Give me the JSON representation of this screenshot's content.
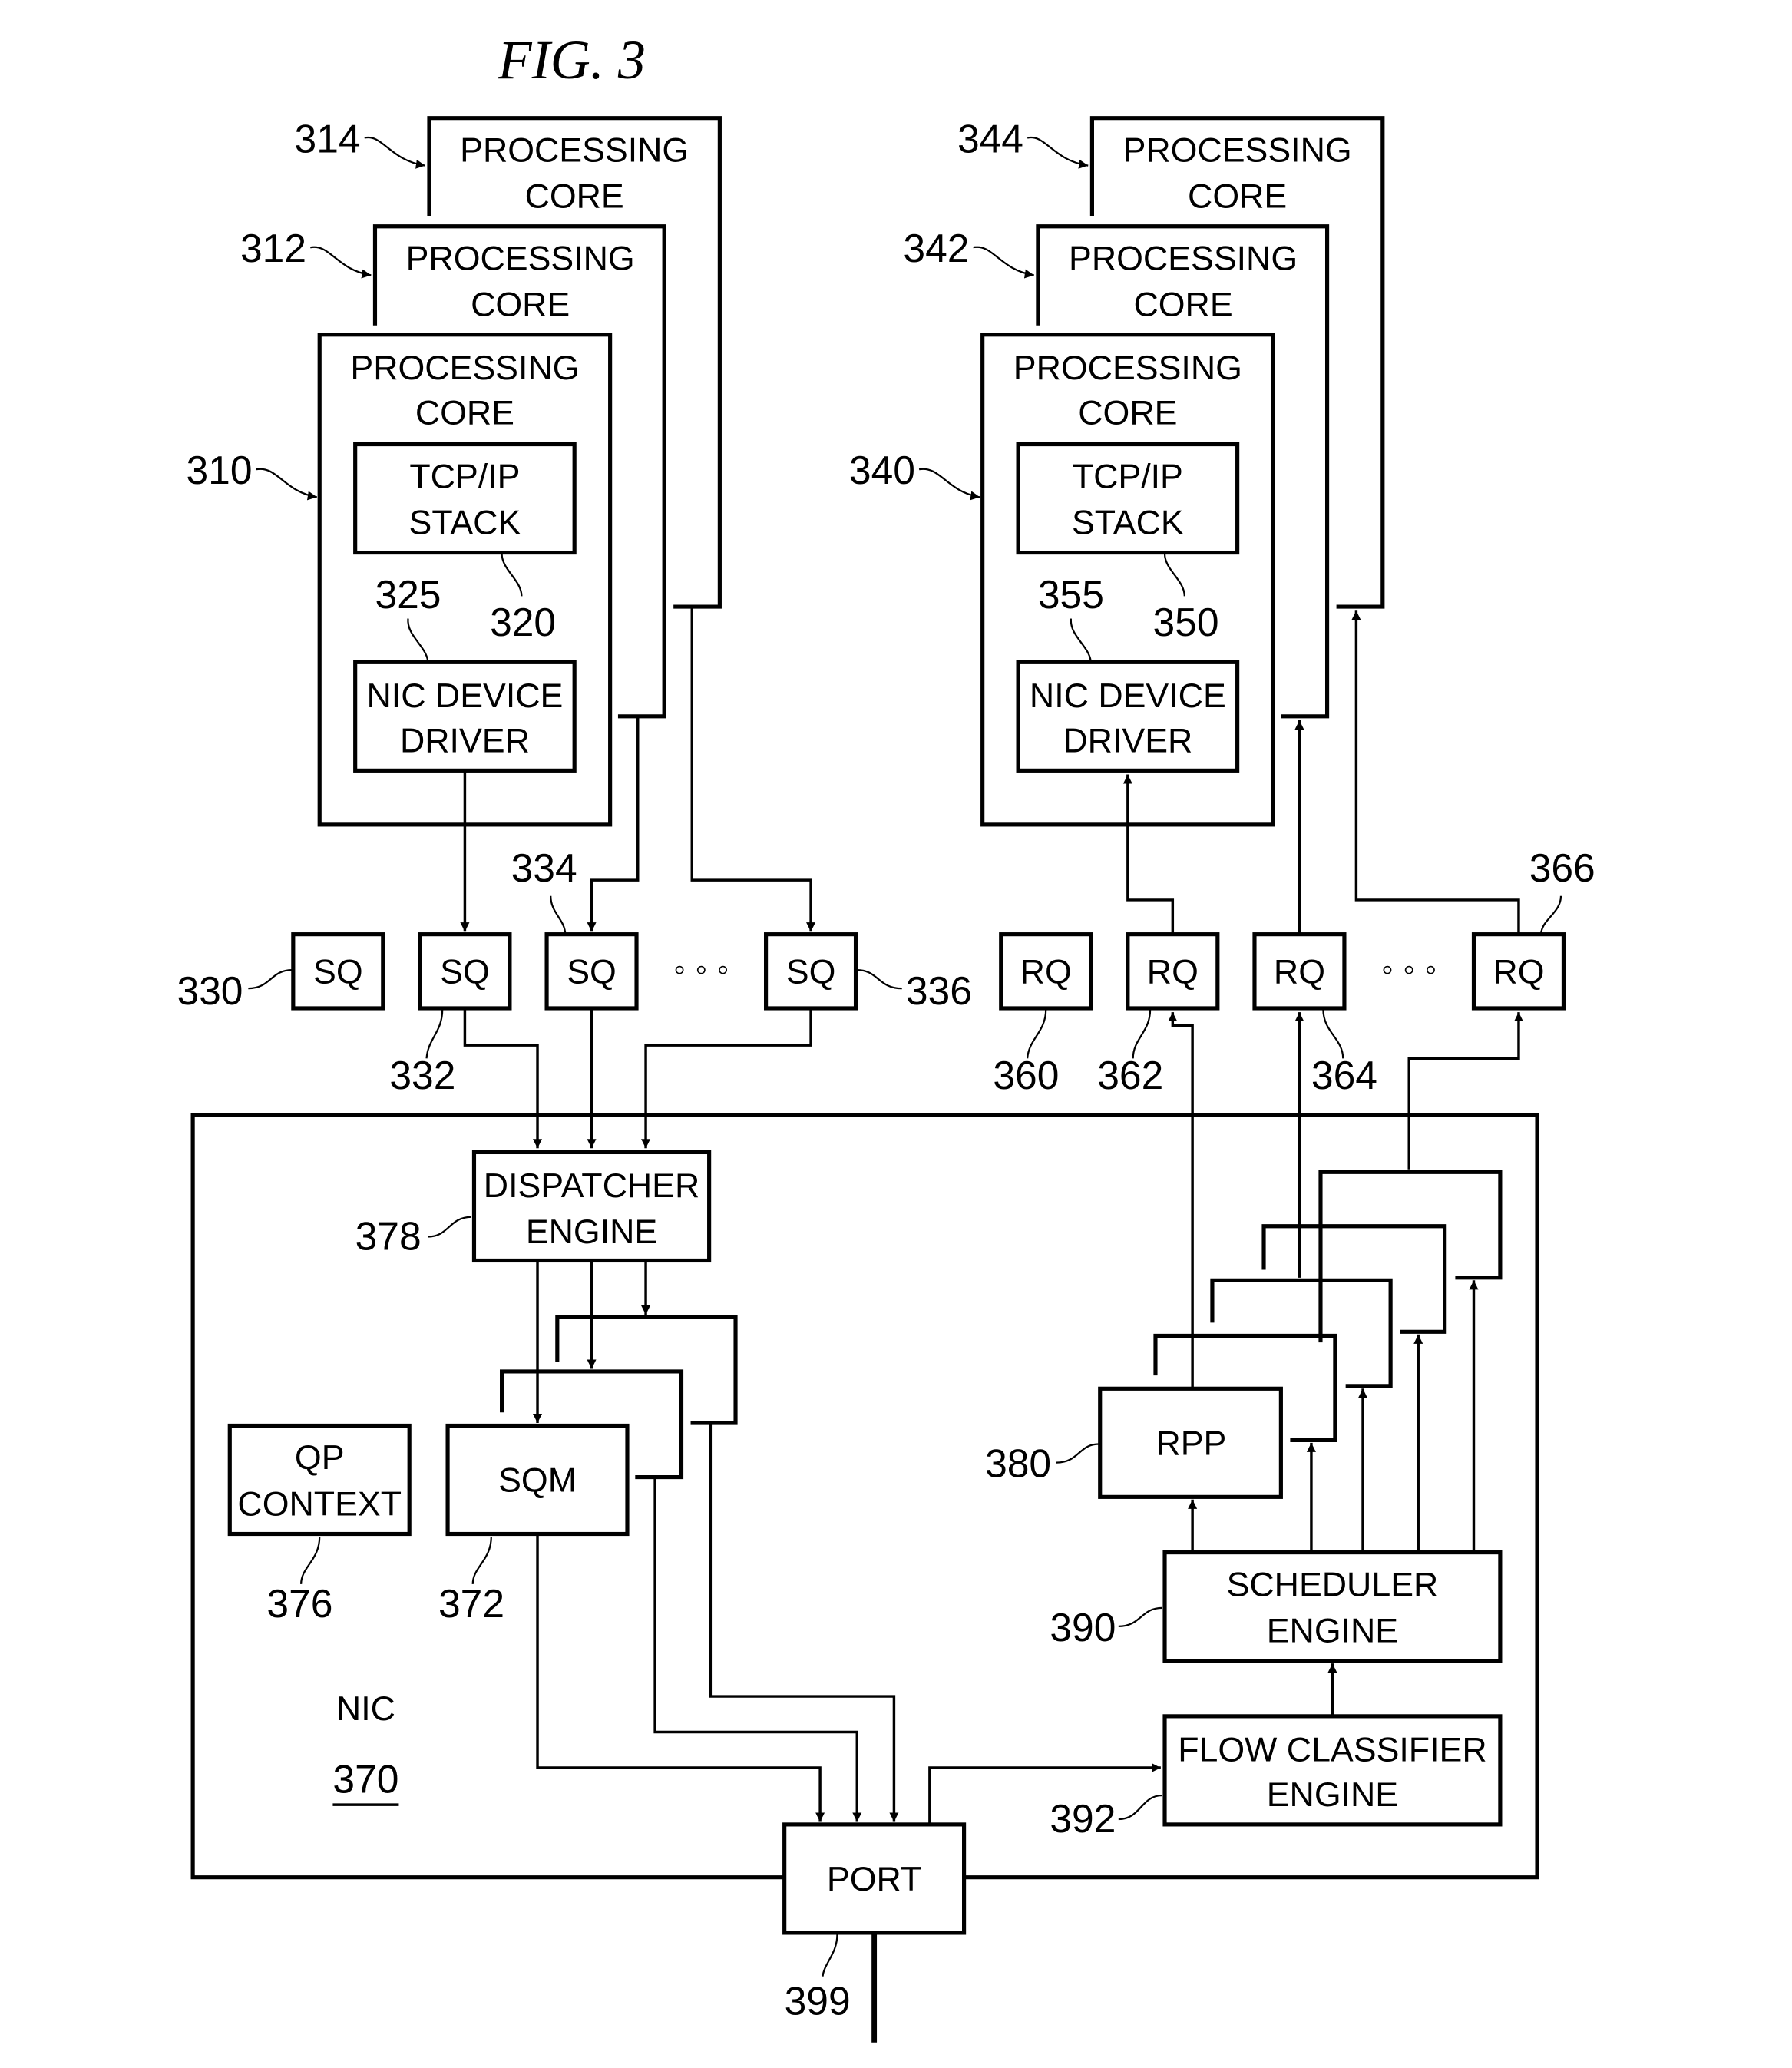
{
  "figure": {
    "title": "FIG. 3"
  },
  "host_left": {
    "cores": [
      {
        "ref": "314",
        "label_line1": "PROCESSING",
        "label_line2": "CORE"
      },
      {
        "ref": "312",
        "label_line1": "PROCESSING",
        "label_line2": "CORE"
      },
      {
        "ref": "310",
        "label_line1": "PROCESSING",
        "label_line2": "CORE"
      }
    ],
    "tcp_ip_stack": {
      "ref": "320",
      "line1": "TCP/IP",
      "line2": "STACK"
    },
    "nic_driver": {
      "ref": "325",
      "line1": "NIC DEVICE",
      "line2": "DRIVER"
    }
  },
  "host_right": {
    "cores": [
      {
        "ref": "344",
        "label_line1": "PROCESSING",
        "label_line2": "CORE"
      },
      {
        "ref": "342",
        "label_line1": "PROCESSING",
        "label_line2": "CORE"
      },
      {
        "ref": "340",
        "label_line1": "PROCESSING",
        "label_line2": "CORE"
      }
    ],
    "tcp_ip_stack": {
      "ref": "350",
      "line1": "TCP/IP",
      "line2": "STACK"
    },
    "nic_driver": {
      "ref": "355",
      "line1": "NIC DEVICE",
      "line2": "DRIVER"
    }
  },
  "send_queues": [
    {
      "ref": "330",
      "label": "SQ"
    },
    {
      "ref": "332",
      "label": "SQ"
    },
    {
      "ref": "334",
      "label": "SQ"
    },
    {
      "ref": "336",
      "label": "SQ"
    }
  ],
  "receive_queues": [
    {
      "ref": "360",
      "label": "RQ"
    },
    {
      "ref": "362",
      "label": "RQ"
    },
    {
      "ref": "364",
      "label": "RQ"
    },
    {
      "ref": "366",
      "label": "RQ"
    }
  ],
  "ellipsis": "◦ ◦ ◦",
  "nic": {
    "label": "NIC",
    "ref": "370",
    "dispatcher": {
      "ref": "378",
      "line1": "DISPATCHER",
      "line2": "ENGINE"
    },
    "qp_context": {
      "ref": "376",
      "line1": "QP",
      "line2": "CONTEXT"
    },
    "sqm": {
      "ref": "372",
      "label": "SQM"
    },
    "rpp": {
      "ref": "380",
      "label": "RPP"
    },
    "scheduler": {
      "ref": "390",
      "line1": "SCHEDULER",
      "line2": "ENGINE"
    },
    "flow_classifier": {
      "ref": "392",
      "line1": "FLOW CLASSIFIER",
      "line2": "ENGINE"
    },
    "port": {
      "ref": "399",
      "label": "PORT"
    }
  }
}
